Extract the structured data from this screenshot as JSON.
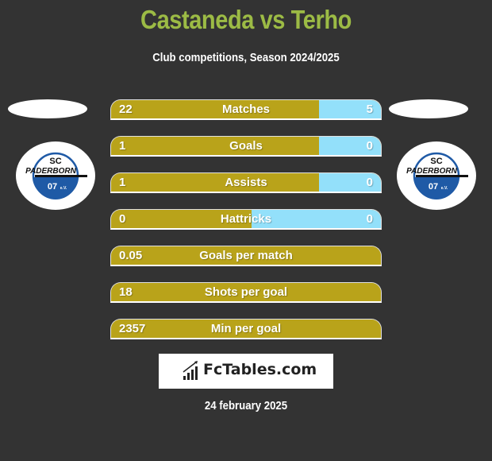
{
  "header": {
    "title": "Castaneda vs Terho",
    "subtitle": "Club competitions, Season 2024/2025"
  },
  "teams": {
    "left": {
      "name": "SC Paderborn 07",
      "badge_text_top": "SC",
      "badge_text_mid": "PADERBORN",
      "badge_text_bottom": "07",
      "badge_suffix": "e.V."
    },
    "right": {
      "name": "SC Paderborn 07",
      "badge_text_top": "SC",
      "badge_text_mid": "PADERBORN",
      "badge_text_bottom": "07",
      "badge_suffix": "e.V."
    }
  },
  "colors": {
    "left_bar": "#b9a31a",
    "right_bar": "#93e0fa",
    "title": "#9cbb45",
    "background": "#333333",
    "badge_blue": "#1f5aa6"
  },
  "stats": [
    {
      "label": "Matches",
      "left": "22",
      "right": "5",
      "left_share": 0.77
    },
    {
      "label": "Goals",
      "left": "1",
      "right": "0",
      "left_share": 0.77
    },
    {
      "label": "Assists",
      "left": "1",
      "right": "0",
      "left_share": 0.77
    },
    {
      "label": "Hattricks",
      "left": "0",
      "right": "0",
      "left_share": 0.52
    },
    {
      "label": "Goals per match",
      "left": "0.05",
      "right": "",
      "left_share": 1.0
    },
    {
      "label": "Shots per goal",
      "left": "18",
      "right": "",
      "left_share": 1.0
    },
    {
      "label": "Min per goal",
      "left": "2357",
      "right": "",
      "left_share": 1.0
    }
  ],
  "brand": {
    "name": "FcTables.com",
    "icon": "bar-chart-icon"
  },
  "footer": {
    "date": "24 february 2025"
  }
}
